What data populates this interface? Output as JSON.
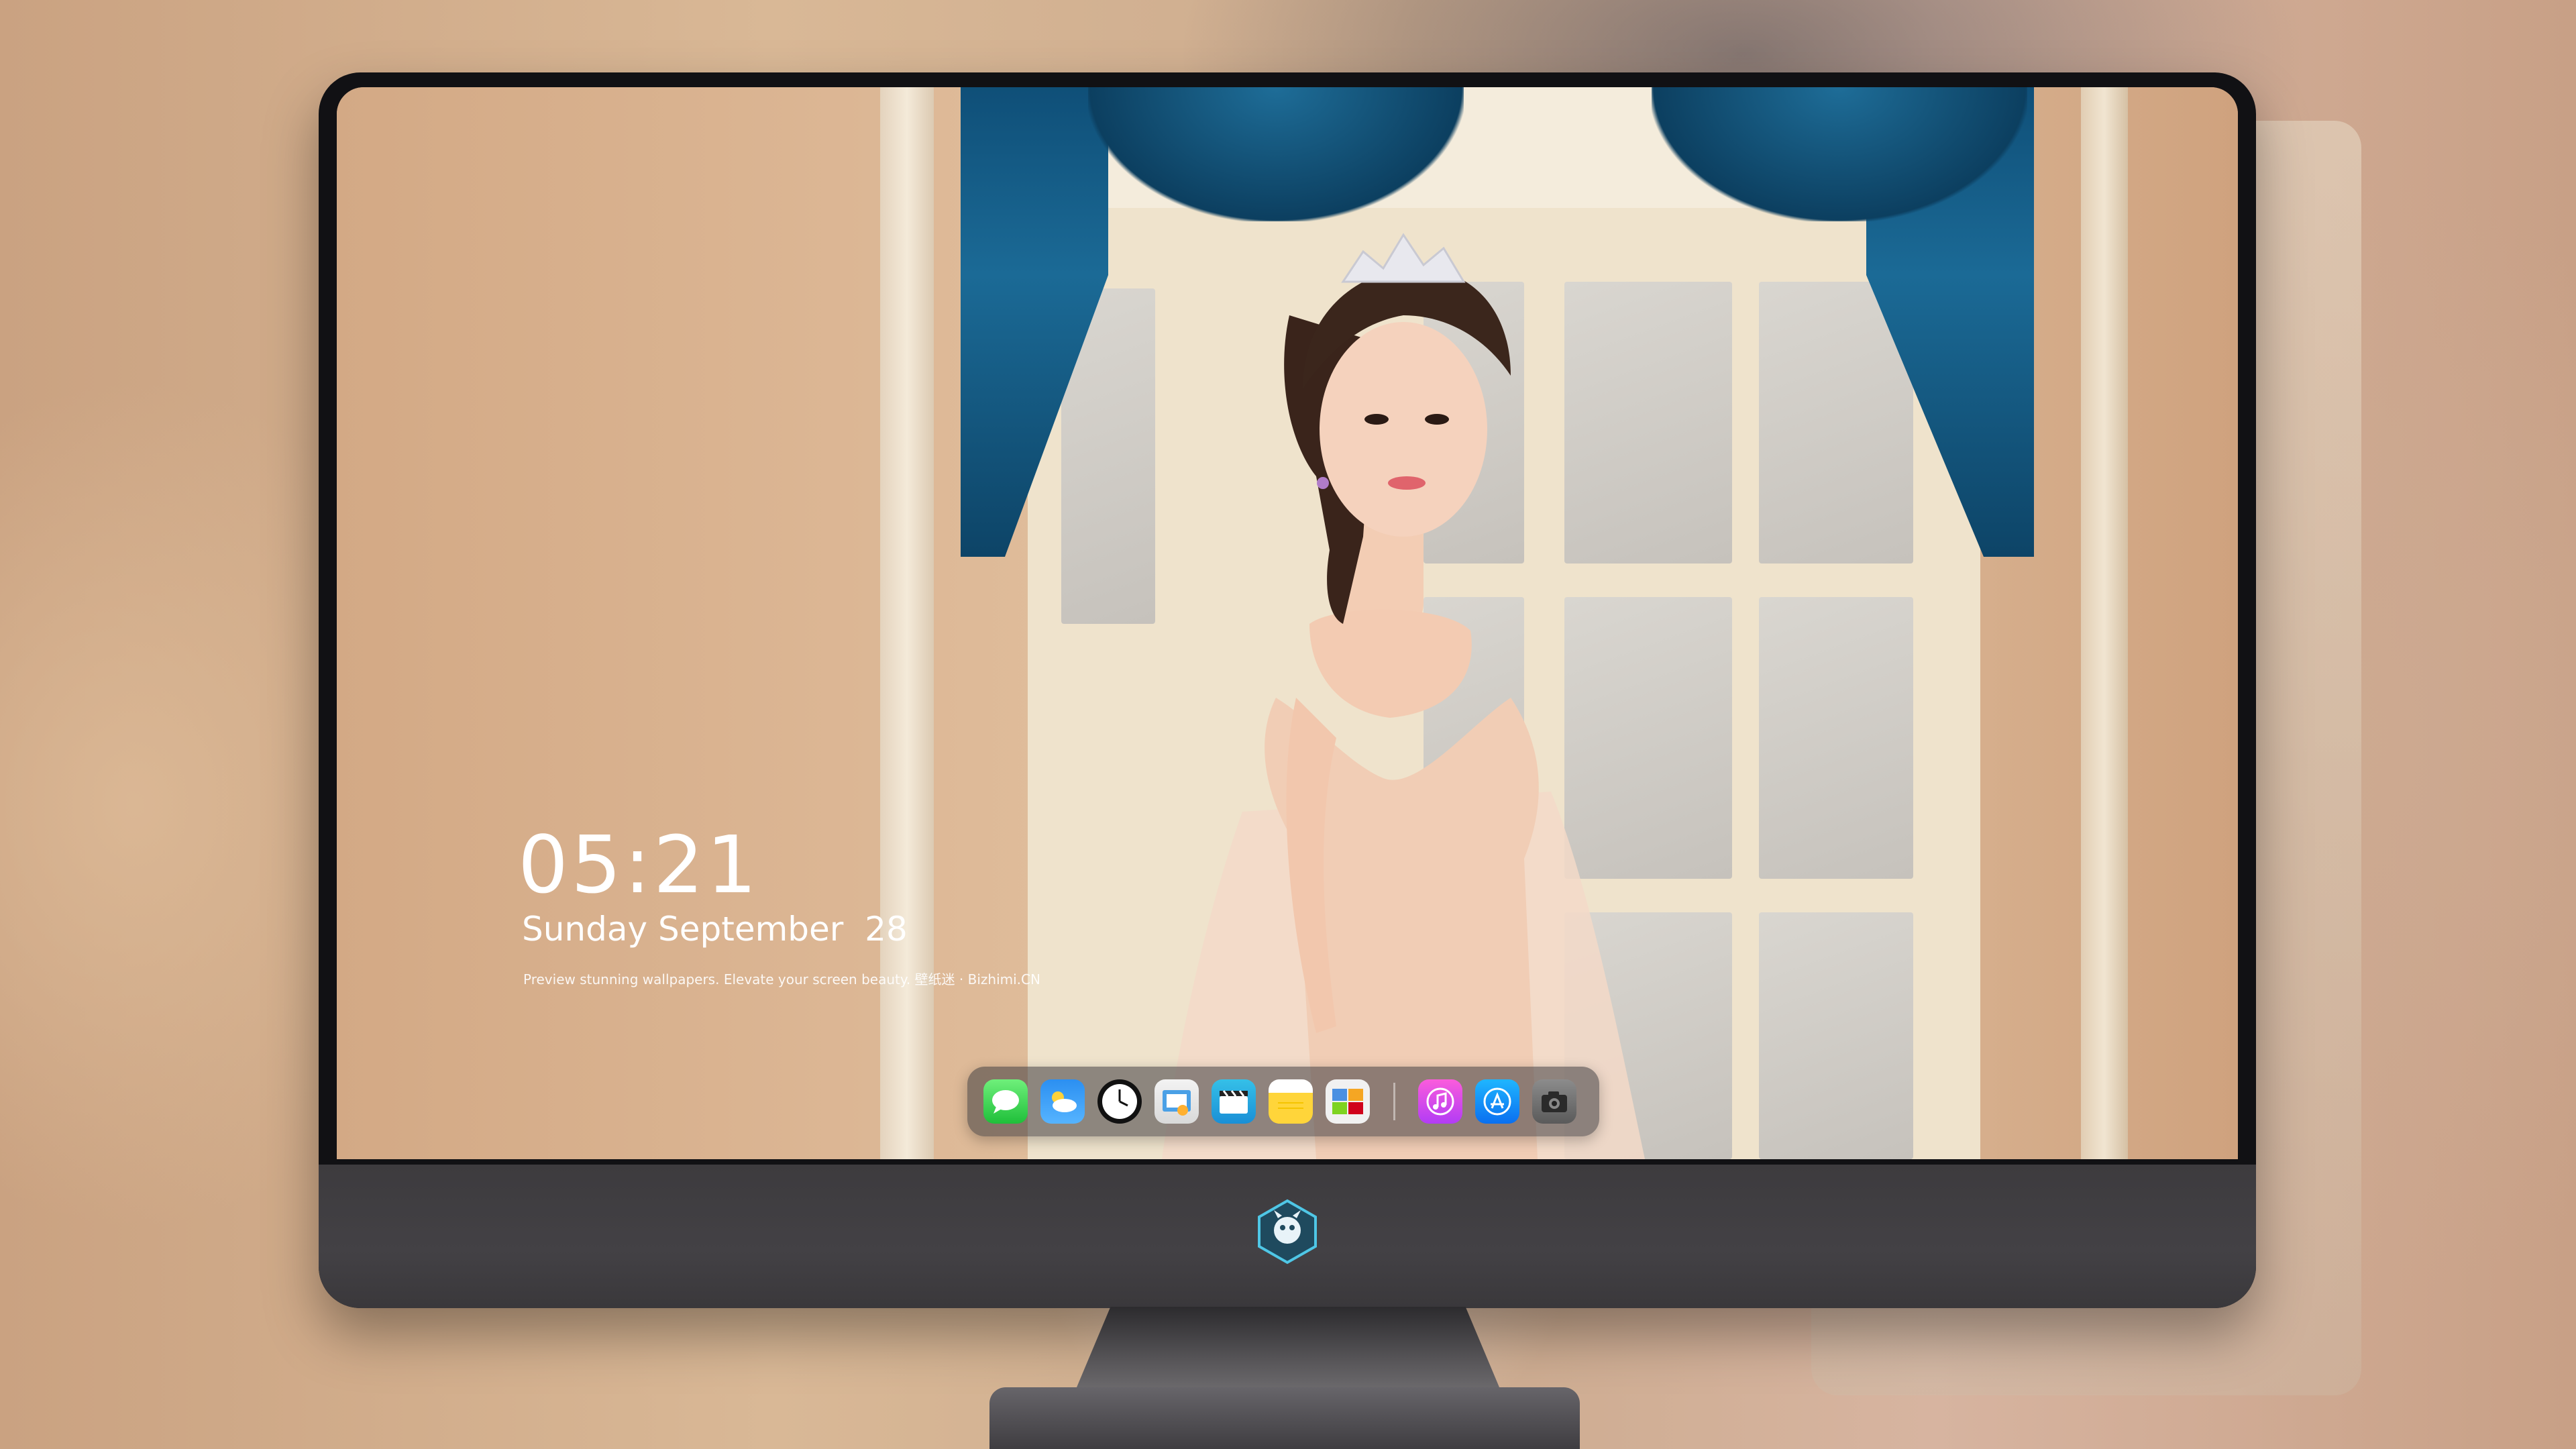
{
  "lock_screen": {
    "time": "05:21",
    "date": "Sunday September  28",
    "tagline": "Preview stunning wallpapers. Elevate your screen beauty. 壁纸迷 · Bizhimi.CN"
  },
  "dock": {
    "apps": [
      {
        "name": "Messages",
        "icon": "messages-icon"
      },
      {
        "name": "Weather",
        "icon": "weather-icon"
      },
      {
        "name": "Clock",
        "icon": "clock-icon"
      },
      {
        "name": "Preview",
        "icon": "preview-icon"
      },
      {
        "name": "Clips",
        "icon": "clapperboard-icon"
      },
      {
        "name": "Notes",
        "icon": "notes-icon"
      },
      {
        "name": "Photos",
        "icon": "photo-gallery-icon"
      },
      {
        "name": "Music",
        "icon": "music-note-icon"
      },
      {
        "name": "App Store",
        "icon": "app-store-icon"
      },
      {
        "name": "Camera",
        "icon": "camera-icon"
      }
    ]
  },
  "monitor": {
    "logo": "dragon-mascot-logo"
  },
  "colors": {
    "monitor_bezel": "#111114",
    "monitor_chin": "#403e41",
    "curtain": "#14608c",
    "wall": "#d8b08c"
  }
}
